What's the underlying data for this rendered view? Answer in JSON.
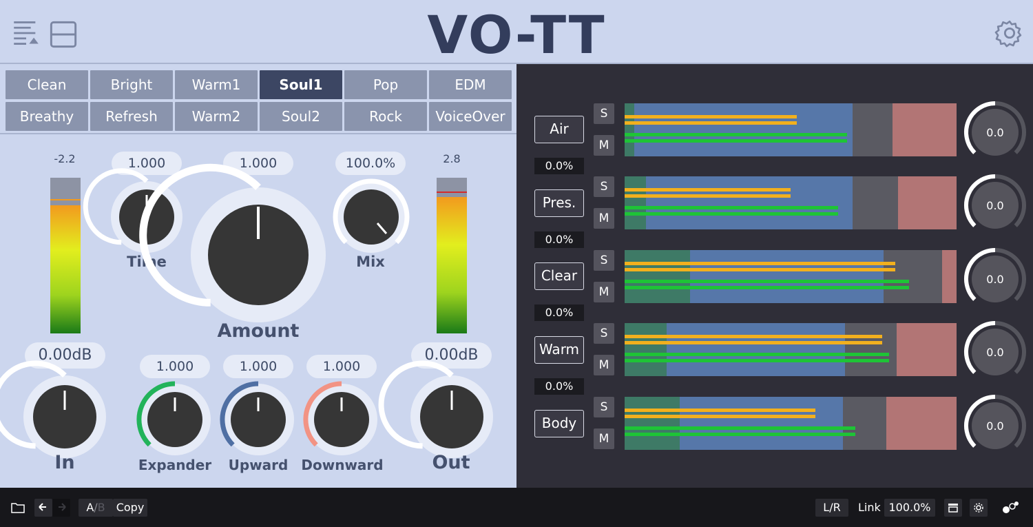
{
  "app": {
    "title": "VO-TT"
  },
  "presets": {
    "row1": [
      "Clean",
      "Bright",
      "Warm1",
      "Soul1",
      "Pop",
      "EDM"
    ],
    "row2": [
      "Breathy",
      "Refresh",
      "Warm2",
      "Soul2",
      "Rock",
      "VoiceOver"
    ],
    "selected": "Soul1"
  },
  "input": {
    "meter_peak": "-2.2",
    "gain": "0.00dB",
    "label": "In"
  },
  "output": {
    "meter_peak": "2.8",
    "gain": "0.00dB",
    "label": "Out"
  },
  "knobs": {
    "time": {
      "label": "Time",
      "value": "1.000"
    },
    "amount": {
      "label": "Amount",
      "value": "1.000"
    },
    "mix": {
      "label": "Mix",
      "value": "100.0%"
    },
    "expander": {
      "label": "Expander",
      "value": "1.000"
    },
    "upward": {
      "label": "Upward",
      "value": "1.000"
    },
    "downward": {
      "label": "Downward",
      "value": "1.000"
    }
  },
  "bands": [
    {
      "name": "Air",
      "percent": "0.0%",
      "knob": "0.0",
      "solo": "S",
      "mute": "M"
    },
    {
      "name": "Pres.",
      "percent": "0.0%",
      "knob": "0.0",
      "solo": "S",
      "mute": "M"
    },
    {
      "name": "Clear",
      "percent": "0.0%",
      "knob": "0.0",
      "solo": "S",
      "mute": "M"
    },
    {
      "name": "Warm",
      "percent": "0.0%",
      "knob": "0.0",
      "solo": "S",
      "mute": "M"
    },
    {
      "name": "Body",
      "percent": "",
      "knob": "0.0",
      "solo": "S",
      "mute": "M"
    }
  ],
  "bottom": {
    "ab_a": "A",
    "ab_sep": "/",
    "ab_b": "B",
    "copy": "Copy",
    "lr": "L/R",
    "link_label": "Link",
    "link_value": "100.0%"
  },
  "colors": {
    "panel": "#ccd6ee",
    "dark": "#2f2e38",
    "expander": "#22b35a",
    "upward": "#4f6fa3",
    "downward": "#f29384",
    "meter_yellow": "#f2b01e",
    "meter_green": "#1ec436"
  }
}
